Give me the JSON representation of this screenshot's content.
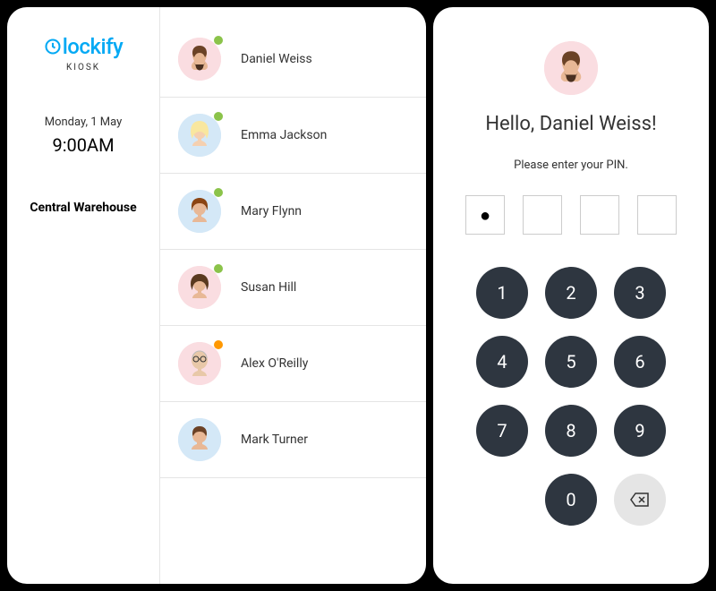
{
  "brand": {
    "name": "lockify",
    "sub": "KIOSK"
  },
  "sidebar": {
    "date": "Monday, 1 May",
    "time": "9:00AM",
    "location": "Central Warehouse"
  },
  "users": [
    {
      "name": "Daniel Weiss",
      "status": "green",
      "avatar_bg": "pink"
    },
    {
      "name": "Emma Jackson",
      "status": "green",
      "avatar_bg": "blue"
    },
    {
      "name": "Mary Flynn",
      "status": "green",
      "avatar_bg": "blue"
    },
    {
      "name": "Susan Hill",
      "status": "green",
      "avatar_bg": "pink"
    },
    {
      "name": "Alex O'Reilly",
      "status": "orange",
      "avatar_bg": "pink"
    },
    {
      "name": "Mark Turner",
      "status": "none",
      "avatar_bg": "blue"
    }
  ],
  "pin_screen": {
    "greeting": "Hello, Daniel Weiss!",
    "prompt": "Please enter your PIN.",
    "entered_count": 1,
    "total_digits": 4
  },
  "keypad": {
    "k1": "1",
    "k2": "2",
    "k3": "3",
    "k4": "4",
    "k5": "5",
    "k6": "6",
    "k7": "7",
    "k8": "8",
    "k9": "9",
    "k0": "0"
  }
}
